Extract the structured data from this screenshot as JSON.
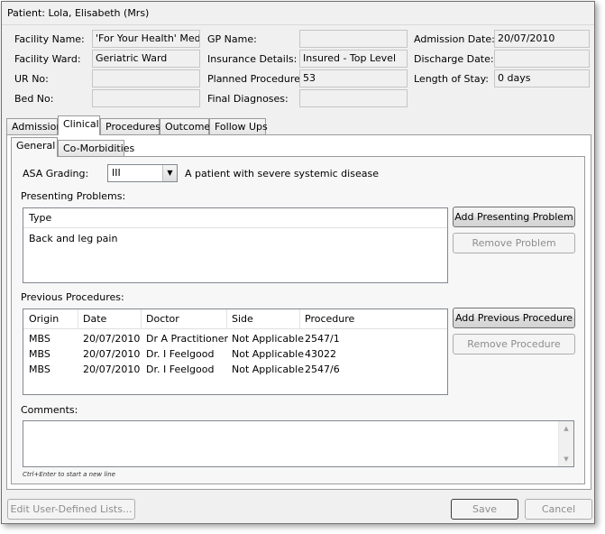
{
  "window": {
    "title": "Patient: Lola, Elisabeth (Mrs)"
  },
  "header": {
    "facility_name_label": "Facility Name:",
    "facility_name_value": "'For Your Health' Medica",
    "facility_ward_label": "Facility Ward:",
    "facility_ward_value": "Geriatric Ward",
    "ur_no_label": "UR No:",
    "ur_no_value": "",
    "bed_no_label": "Bed No:",
    "bed_no_value": "",
    "gp_name_label": "GP Name:",
    "gp_name_value": "",
    "insurance_label": "Insurance Details:",
    "insurance_value": "Insured - Top Level",
    "planned_procedures_label": "Planned Procedures:",
    "planned_procedures_value": "53",
    "final_diagnoses_label": "Final Diagnoses:",
    "final_diagnoses_value": "",
    "admission_date_label": "Admission Date:",
    "admission_date_value": "20/07/2010",
    "discharge_date_label": "Discharge Date:",
    "discharge_date_value": "",
    "length_of_stay_label": "Length of Stay:",
    "length_of_stay_value": "0 days"
  },
  "tabs": [
    "Admission",
    "Clinical",
    "Procedures",
    "Outcome",
    "Follow Ups"
  ],
  "active_tab": "Clinical",
  "subtabs": [
    "General",
    "Co-Morbidities"
  ],
  "active_subtab": "General",
  "asa": {
    "label": "ASA Grading:",
    "value": "III",
    "description": "A patient with severe systemic disease"
  },
  "presenting_problems": {
    "label": "Presenting Problems:",
    "columns": [
      "Type"
    ],
    "rows": [
      [
        "Back and leg pain"
      ]
    ],
    "add_button": "Add Presenting Problem",
    "remove_button": "Remove Problem"
  },
  "previous_procedures": {
    "label": "Previous Procedures:",
    "columns": [
      "Origin",
      "Date",
      "Doctor",
      "Side",
      "Procedure"
    ],
    "rows": [
      [
        "MBS",
        "20/07/2010",
        "Dr A Practitioner",
        "Not Applicable",
        "2547/1"
      ],
      [
        "MBS",
        "20/07/2010",
        "Dr. I Feelgood",
        "Not Applicable",
        "43022"
      ],
      [
        "MBS",
        "20/07/2010",
        "Dr. I Feelgood",
        "Not Applicable",
        "2547/6"
      ]
    ],
    "add_button": "Add Previous Procedure",
    "remove_button": "Remove Procedure"
  },
  "comments": {
    "label": "Comments:",
    "value": "",
    "hint": "Ctrl+Enter to start a new line"
  },
  "footer": {
    "edit_lists_button": "Edit User-Defined Lists...",
    "save_button": "Save",
    "cancel_button": "Cancel"
  }
}
